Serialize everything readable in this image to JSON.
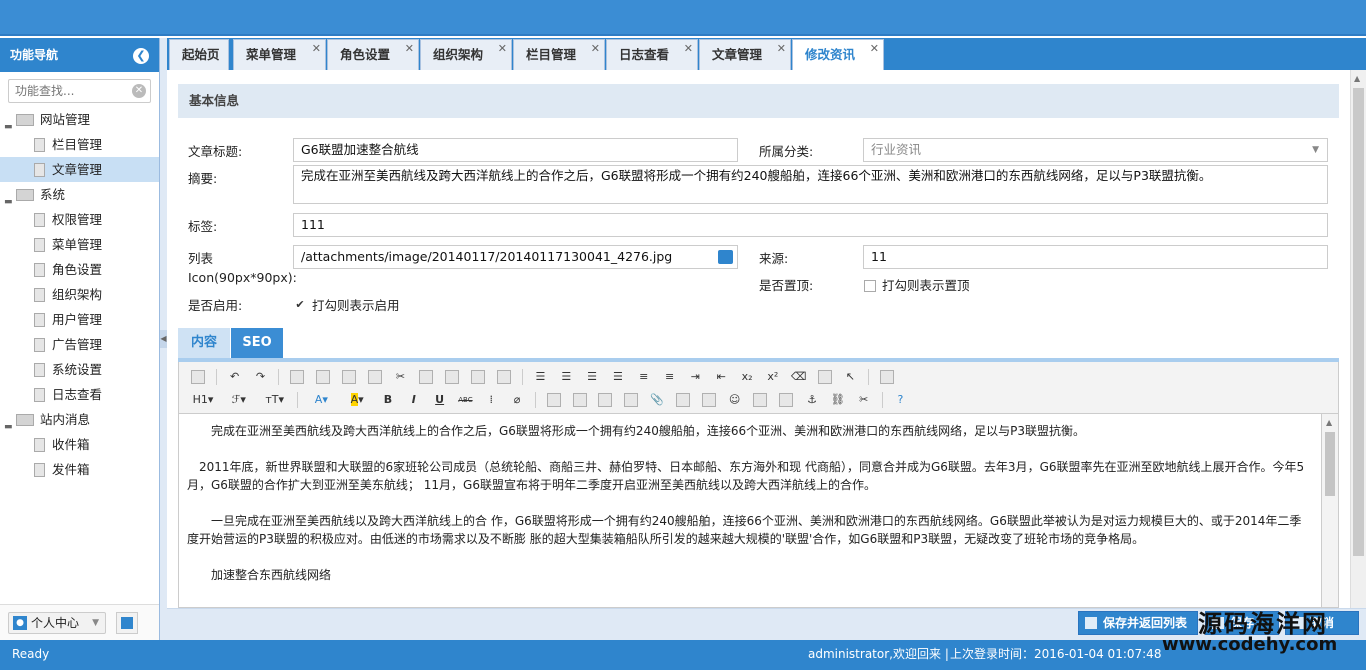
{
  "sidebar": {
    "title": "功能导航",
    "collapse_icon": "chevron-left-icon",
    "search_placeholder": "功能查找...",
    "tree": [
      {
        "label": "网站管理",
        "children": [
          "栏目管理",
          "文章管理"
        ]
      },
      {
        "label": "系统",
        "children": [
          "权限管理",
          "菜单管理",
          "角色设置",
          "组织架构",
          "用户管理",
          "广告管理",
          "系统设置",
          "日志查看"
        ]
      },
      {
        "label": "站内消息",
        "children": [
          "收件箱",
          "发件箱"
        ]
      }
    ],
    "selected": "文章管理",
    "user_menu_label": "个人中心"
  },
  "tabs": [
    {
      "label": "起始页",
      "closable": false
    },
    {
      "label": "菜单管理",
      "closable": true
    },
    {
      "label": "角色设置",
      "closable": true
    },
    {
      "label": "组织架构",
      "closable": true
    },
    {
      "label": "栏目管理",
      "closable": true
    },
    {
      "label": "日志查看",
      "closable": true
    },
    {
      "label": "文章管理",
      "closable": true
    },
    {
      "label": "修改资讯",
      "closable": true,
      "active": true
    }
  ],
  "form": {
    "section_title": "基本信息",
    "title_label": "文章标题:",
    "title_value": "G6联盟加速整合航线",
    "category_label": "所属分类:",
    "category_value": "行业资讯",
    "summary_label": "摘要:",
    "summary_value": "完成在亚洲至美西航线及跨大西洋航线上的合作之后，G6联盟将形成一个拥有约240艘船舶，连接66个亚洲、美洲和欧洲港口的东西航线网络，足以与P3联盟抗衡。",
    "tags_label": "标签:",
    "tags_value": "111",
    "icon_label_line1": "列表",
    "icon_label_line2": "Icon(90px*90px):",
    "icon_value": "/attachments/image/20140117/20140117130041_4276.jpg",
    "source_label": "来源:",
    "source_value": "11",
    "top_label": "是否置顶:",
    "top_check_label": "打勾则表示置顶",
    "top_checked": false,
    "enabled_label": "是否启用:",
    "enabled_check_label": "打勾则表示启用",
    "enabled_checked": true
  },
  "content_tabs": {
    "content": "内容",
    "seo": "SEO"
  },
  "editor": {
    "toolbar_labels": {
      "heading": "H1",
      "font_family": "ℱ",
      "font_size": "тT",
      "font_color": "A",
      "bg_color": "A",
      "bold": "B",
      "italic": "I",
      "underline": "U",
      "strike": "ABC",
      "subscript": "x₂",
      "superscript": "x²"
    },
    "paragraphs": [
      "完成在亚洲至美西航线及跨大西洋航线上的合作之后，G6联盟将形成一个拥有约240艘船舶，连接66个亚洲、美洲和欧洲港口的东西航线网络，足以与P3联盟抗衡。",
      "2011年底，新世界联盟和大联盟的6家班轮公司成员（总统轮船、商船三井、赫伯罗特、日本邮船、东方海外和现 代商船），同意合并成为G6联盟。去年3月，G6联盟率先在亚洲至欧地航线上展开合作。今年5月，G6联盟的合作扩大到亚洲至美东航线； 11月，G6联盟宣布将于明年二季度开启亚洲至美西航线以及跨大西洋航线上的合作。",
      "一旦完成在亚洲至美西航线以及跨大西洋航线上的合 作，G6联盟将形成一个拥有约240艘船舶，连接66个亚洲、美洲和欧洲港口的东西航线网络。G6联盟此举被认为是对运力规模巨大的、或于2014年二季度开始营运的P3联盟的积极应对。由低迷的市场需求以及不断膨 胀的超大型集装箱船队所引发的越来越大规模的'联盟'合作，如G6联盟和P3联盟，无疑改变了班轮市场的竞争格局。",
      "加速整合东西航线网络"
    ]
  },
  "actions": {
    "save_back": "保存并返回列表",
    "save": "保存",
    "cancel": "取消"
  },
  "status": {
    "ready": "Ready",
    "user": "administrator,欢迎回来",
    "separator": "|",
    "last_login": "上次登录时间：2016-01-04 01:07:48"
  },
  "watermark": {
    "line1": "源码海洋网",
    "line2": "www.codehy.com"
  }
}
